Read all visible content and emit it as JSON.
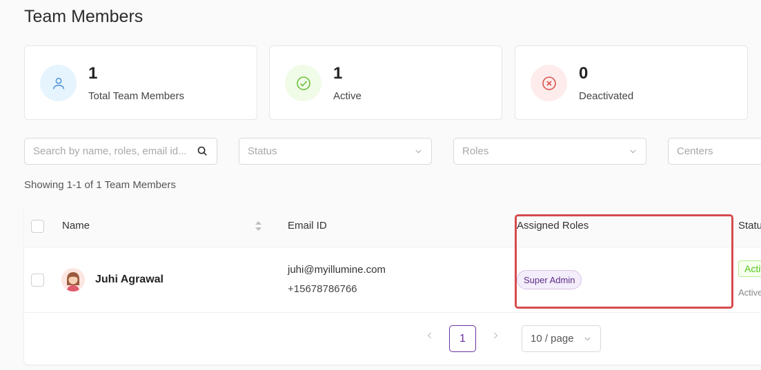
{
  "page": {
    "title": "Team Members"
  },
  "stats": [
    {
      "value": "1",
      "label": "Total Team Members",
      "icon": "user-icon",
      "color": "#4a90d9",
      "bg": "#e6f4fd"
    },
    {
      "value": "1",
      "label": "Active",
      "icon": "check-circle-icon",
      "color": "#6cbf3c",
      "bg": "#f0fbe8"
    },
    {
      "value": "0",
      "label": "Deactivated",
      "icon": "close-circle-icon",
      "color": "#d9534f",
      "bg": "#fdeceb"
    }
  ],
  "filters": {
    "search_placeholder": "Search by name, roles, email id...",
    "status_placeholder": "Status",
    "roles_placeholder": "Roles",
    "centers_placeholder": "Centers"
  },
  "showing_text": "Showing 1-1 of 1 Team Members",
  "table": {
    "columns": [
      "Name",
      "Email ID",
      "Assigned Roles",
      "Status"
    ],
    "rows": [
      {
        "name": "Juhi Agrawal",
        "email": "juhi@myillumine.com",
        "phone": "+15678786766",
        "role": "Super Admin",
        "status": "Active",
        "status_sub": "Active"
      }
    ]
  },
  "pagination": {
    "current_page": "1",
    "page_size": "10 / page",
    "prev": "‹",
    "next": "›"
  }
}
